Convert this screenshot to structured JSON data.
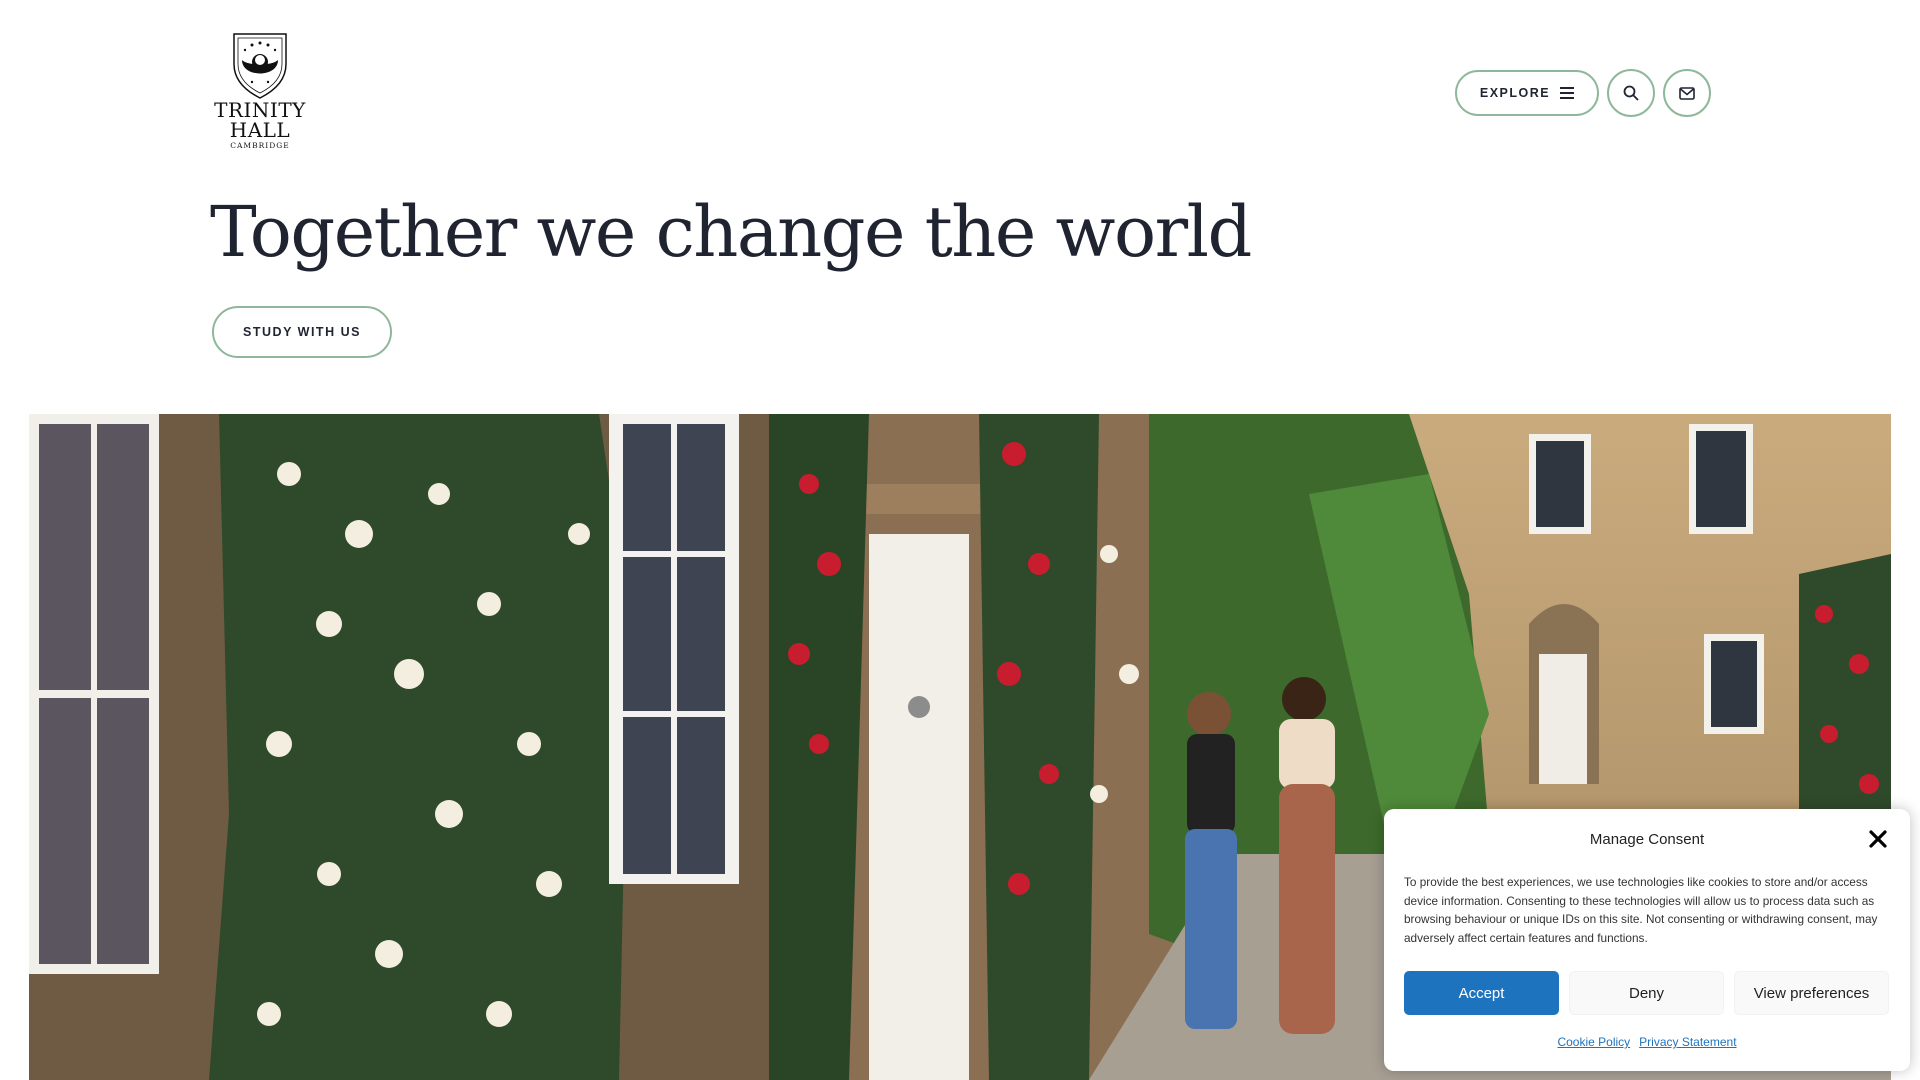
{
  "header": {
    "logo": {
      "line1": "TRINITY",
      "line2": "HALL",
      "line3": "CAMBRIDGE"
    },
    "nav": {
      "explore_label": "EXPLORE",
      "explore_icon": "hamburger-icon",
      "search_icon": "search-icon",
      "mail_icon": "mail-icon"
    }
  },
  "hero": {
    "headline": "Together we change the world",
    "cta_label": "STUDY WITH US"
  },
  "consent": {
    "title": "Manage Consent",
    "body": "To provide the best experiences, we use technologies like cookies to store and/or access device information. Consenting to these technologies will allow us to process data such as browsing behaviour or unique IDs on this site. Not consenting or withdrawing consent, may adversely affect certain features and functions.",
    "accept_label": "Accept",
    "deny_label": "Deny",
    "preferences_label": "View preferences",
    "cookie_policy_label": "Cookie Policy",
    "privacy_statement_label": "Privacy Statement",
    "close_icon": "close-icon"
  },
  "colors": {
    "accent_border": "#8fb79a",
    "primary_button": "#1e73be",
    "text_dark": "#1f2430"
  }
}
